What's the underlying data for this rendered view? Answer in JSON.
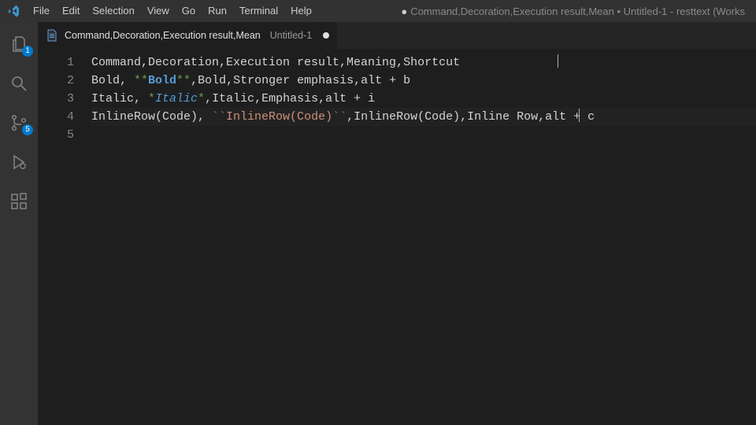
{
  "window": {
    "title_prefix_dot": "●",
    "title": "Command,Decoration,Execution result,Mean • Untitled-1 - resttext (Works"
  },
  "menu": {
    "items": [
      "File",
      "Edit",
      "Selection",
      "View",
      "Go",
      "Run",
      "Terminal",
      "Help"
    ]
  },
  "activity": {
    "explorer_badge": "1",
    "scm_badge": "5"
  },
  "tab": {
    "title": "Command,Decoration,Execution result,Mean",
    "subtitle": "Untitled-1"
  },
  "editor": {
    "line_numbers": [
      "1",
      "2",
      "3",
      "4",
      "5"
    ],
    "lines": {
      "l1": "Command,Decoration,Execution result,Meaning,Shortcut",
      "l2_a": "Bold, ",
      "l2_b_markup1": "**",
      "l2_b_bold": "Bold",
      "l2_b_markup2": "**",
      "l2_c": ",Bold,Stronger emphasis,alt + b",
      "l3_a": "Italic, ",
      "l3_b_markup1": "*",
      "l3_b_italic": "Italic",
      "l3_b_markup2": "*",
      "l3_c": ",Italic,Emphasis,alt + i",
      "l4_a": "InlineRow(Code), ",
      "l4_tick1": "``",
      "l4_code": "InlineRow(Code)",
      "l4_tick2": "``",
      "l4_c": ",InlineRow(Code),Inline Row,alt + c",
      "l5": ""
    }
  }
}
